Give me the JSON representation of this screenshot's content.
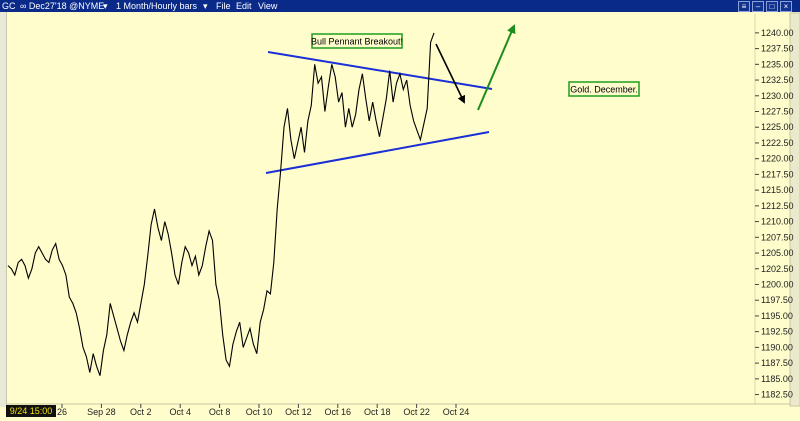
{
  "window": {
    "symbol": "GC",
    "contract": "∞ Dec27'18 @NYME",
    "dropdown_icon": "chevron-down-icon",
    "period": "1 Month/Hourly bars",
    "menu": [
      "File",
      "Edit",
      "View"
    ]
  },
  "colors": {
    "background": "#fefdcb",
    "price_line": "#000000",
    "trendline": "#1a2fd6",
    "arrow_down": "#000000",
    "arrow_up": "#1e8c1e",
    "label_border": "#1e9e1e",
    "cursor_label_bg": "#111111",
    "cursor_label_fg": "#f2e200"
  },
  "chart_data": {
    "type": "line",
    "title": "",
    "xlabel": "",
    "ylabel": "",
    "cursor_label": "9/24 15:00",
    "x_ticks": [
      "26",
      "Sep 28",
      "Oct 2",
      "Oct 4",
      "Oct 8",
      "Oct 10",
      "Oct 12",
      "Oct 16",
      "Oct 18",
      "Oct 22",
      "Oct 24"
    ],
    "y_ticks": [
      "1240.00",
      "1237.50",
      "1235.00",
      "1232.50",
      "1230.00",
      "1227.50",
      "1225.00",
      "1222.50",
      "1220.00",
      "1217.50",
      "1215.00",
      "1212.50",
      "1210.00",
      "1207.50",
      "1205.00",
      "1202.50",
      "1200.00",
      "1197.50",
      "1195.00",
      "1192.50",
      "1190.00",
      "1187.50",
      "1185.00",
      "1182.50"
    ],
    "ylim": [
      1181.0,
      1243.0
    ],
    "grid": false,
    "annotations": [
      "Bull Pennant Breakout!",
      "Gold. December."
    ],
    "series": [
      {
        "values": [
          1203.0,
          1202.5,
          1201.5,
          1203.5,
          1204.0,
          1203.0,
          1201.0,
          1202.5,
          1205.0,
          1206.0,
          1205.0,
          1204.0,
          1203.5,
          1205.5,
          1206.5,
          1204.0,
          1203.0,
          1201.5,
          1198.0,
          1197.0,
          1195.5,
          1193.0,
          1190.0,
          1188.5,
          1186.0,
          1189.0,
          1187.0,
          1185.5,
          1189.5,
          1192.0,
          1197.0,
          1195.0,
          1193.0,
          1191.0,
          1189.5,
          1192.0,
          1194.0,
          1195.5,
          1194.0,
          1197.0,
          1200.0,
          1204.5,
          1209.5,
          1212.0,
          1209.0,
          1207.0,
          1210.0,
          1208.0,
          1205.0,
          1201.5,
          1200.0,
          1203.5,
          1206.0,
          1205.0,
          1203.0,
          1204.5,
          1201.5,
          1203.0,
          1206.0,
          1208.5,
          1207.0,
          1200.0,
          1197.5,
          1192.0,
          1188.0,
          1187.0,
          1190.5,
          1192.5,
          1194.0,
          1190.0,
          1191.5,
          1193.0,
          1190.5,
          1189.0,
          1194.0,
          1196.0,
          1199.0,
          1198.5,
          1203.5,
          1212.0,
          1218.0,
          1225.0,
          1228.0,
          1223.0,
          1220.0,
          1222.5,
          1225.0,
          1221.0,
          1226.0,
          1228.5,
          1235.0,
          1232.0,
          1233.0,
          1227.5,
          1231.5,
          1235.0,
          1233.0,
          1229.0,
          1230.5,
          1225.0,
          1228.0,
          1225.0,
          1227.0,
          1231.0,
          1233.5,
          1229.5,
          1226.0,
          1229.0,
          1226.0,
          1223.5,
          1226.5,
          1229.5,
          1234.0,
          1229.0,
          1232.0,
          1233.5,
          1231.0,
          1232.5,
          1228.5,
          1226.0,
          1224.5,
          1223.0,
          1225.5,
          1228.0,
          1238.5,
          1240.0
        ]
      }
    ]
  }
}
